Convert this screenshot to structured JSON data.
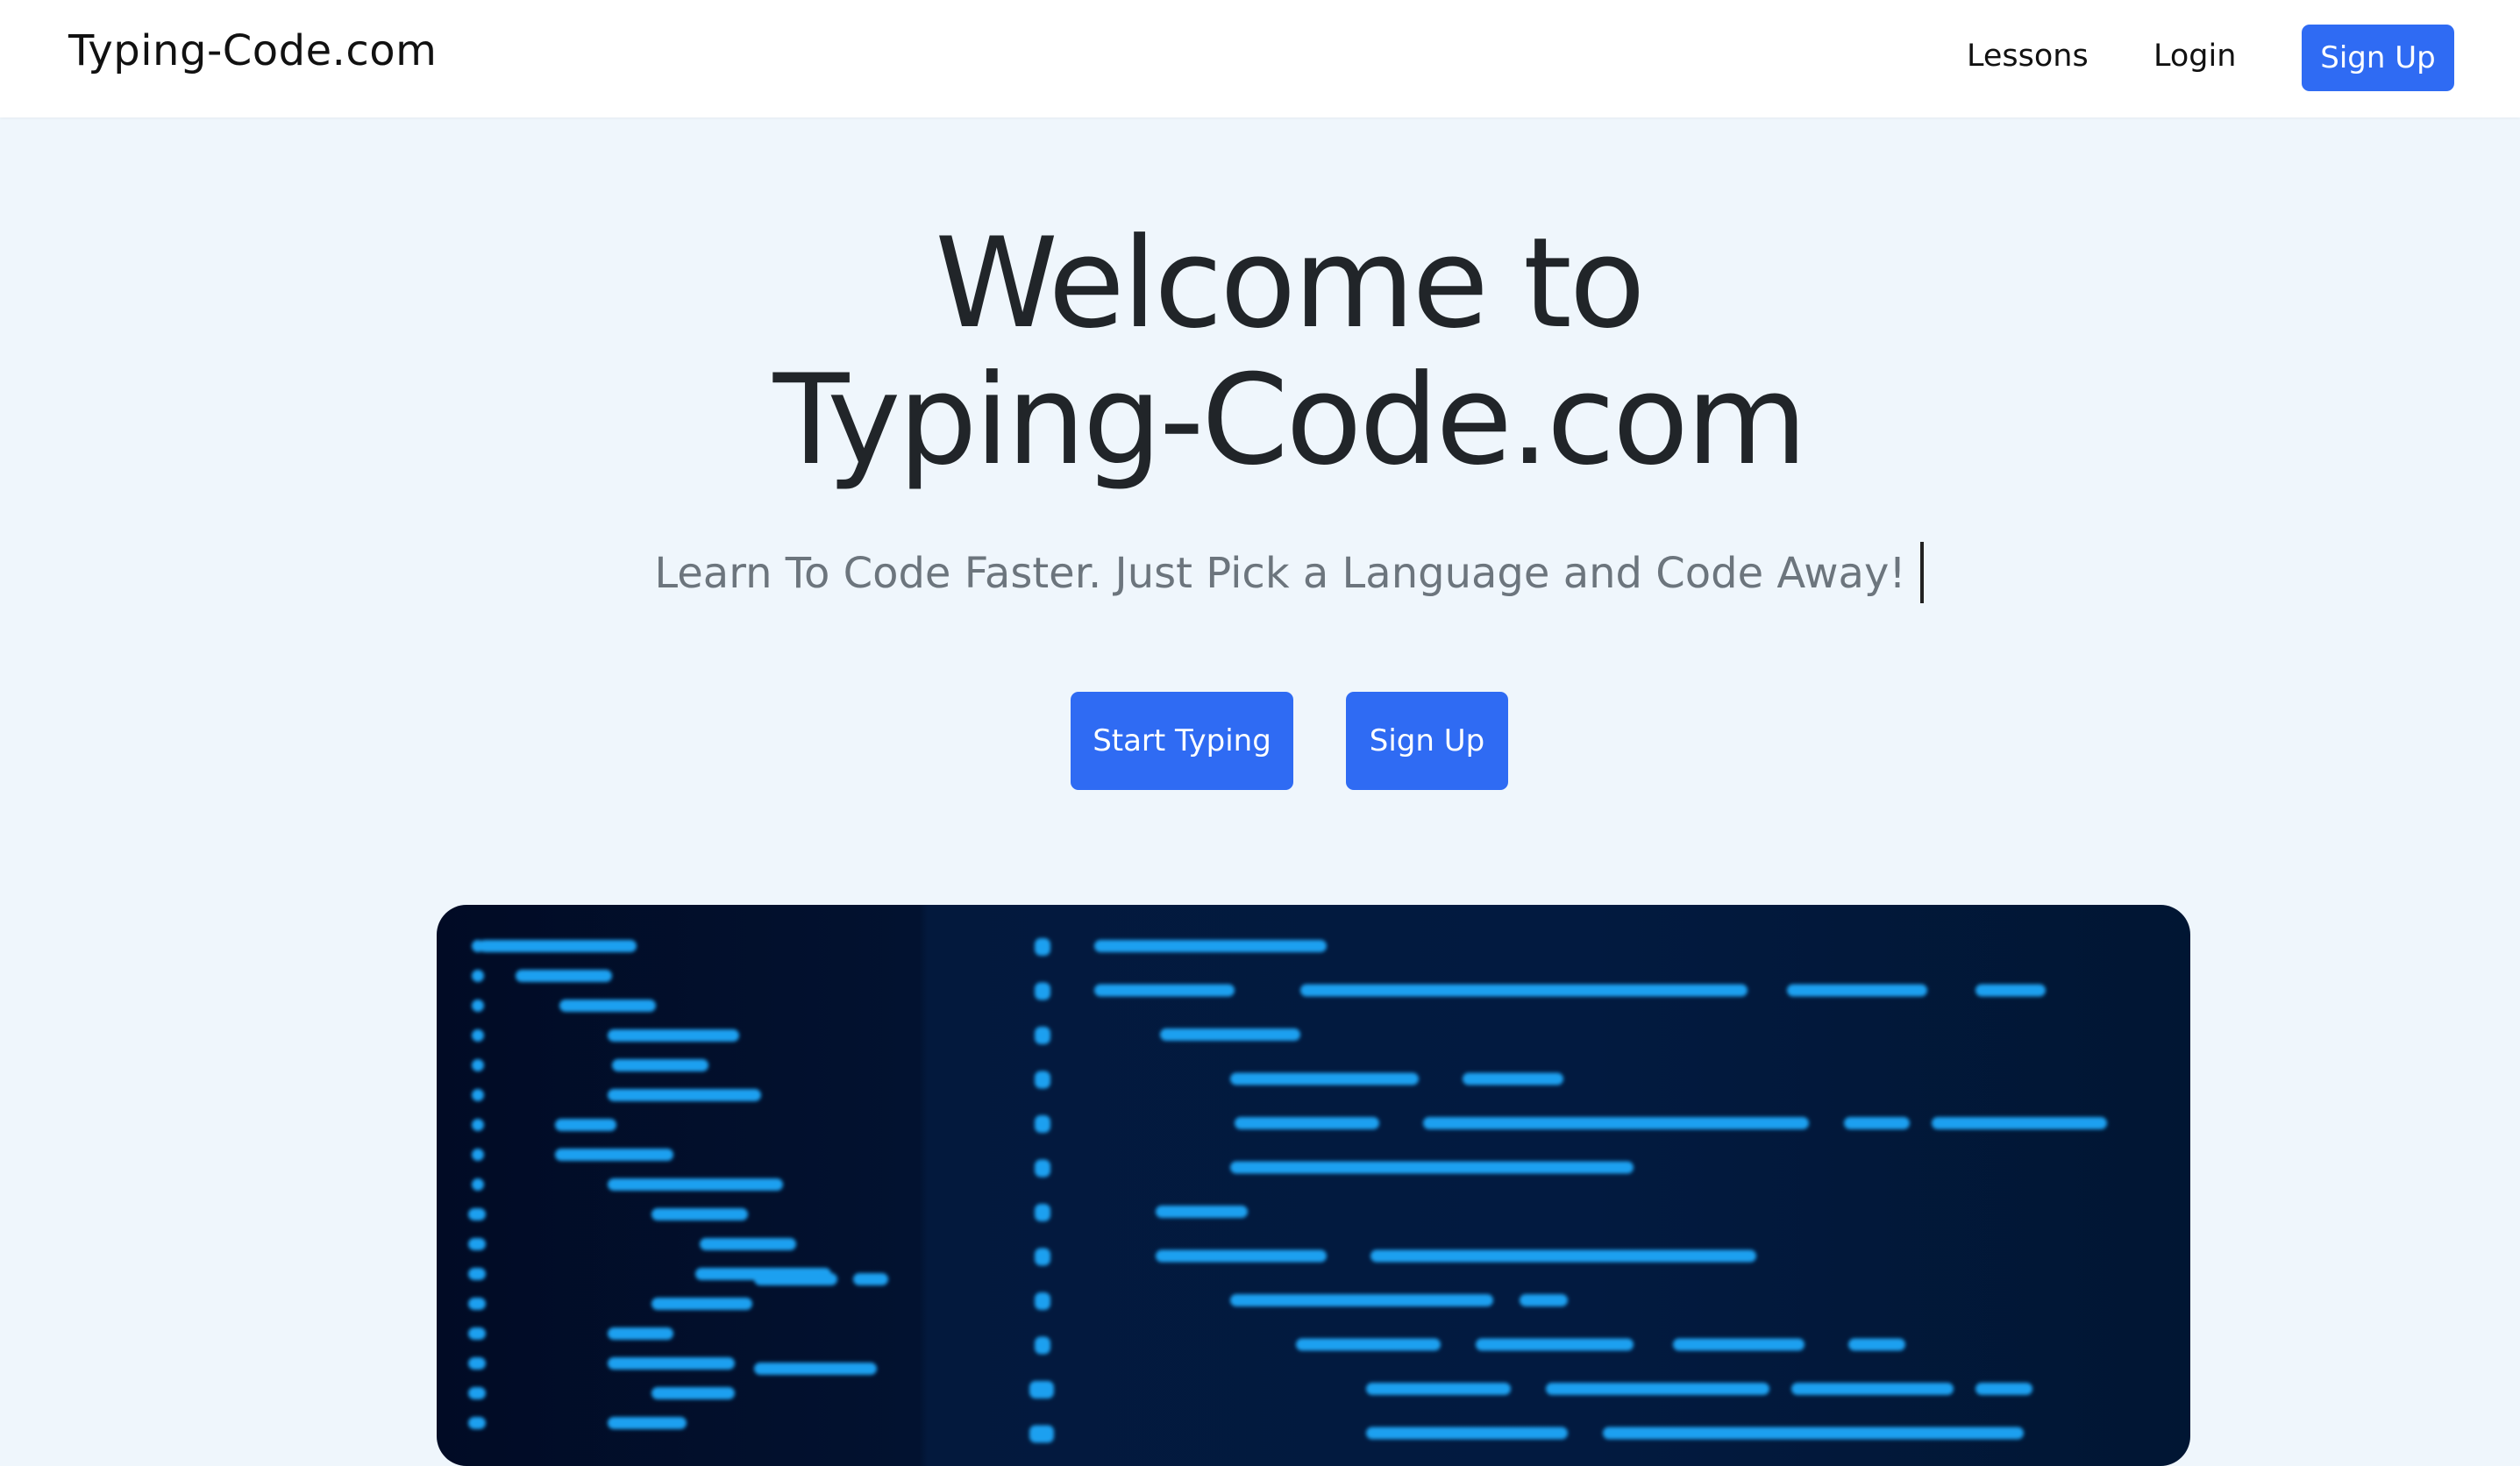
{
  "navbar": {
    "brand": "Typing-Code.com",
    "links": {
      "lessons": "Lessons",
      "login": "Login",
      "signup": "Sign Up"
    }
  },
  "hero": {
    "title_line1": "Welcome to",
    "title_line2": "Typing-Code.com",
    "subtitle": "Learn To Code Faster. Just Pick a Language and Code Away!",
    "buttons": {
      "start": "Start Typing",
      "signup": "Sign Up"
    }
  },
  "colors": {
    "accent": "#2f6bf3",
    "page_bg": "#eff6fc",
    "code_bg": "#021a40",
    "code_line": "#1aa0f0"
  },
  "image": {
    "name": "code-editor-illustration"
  }
}
